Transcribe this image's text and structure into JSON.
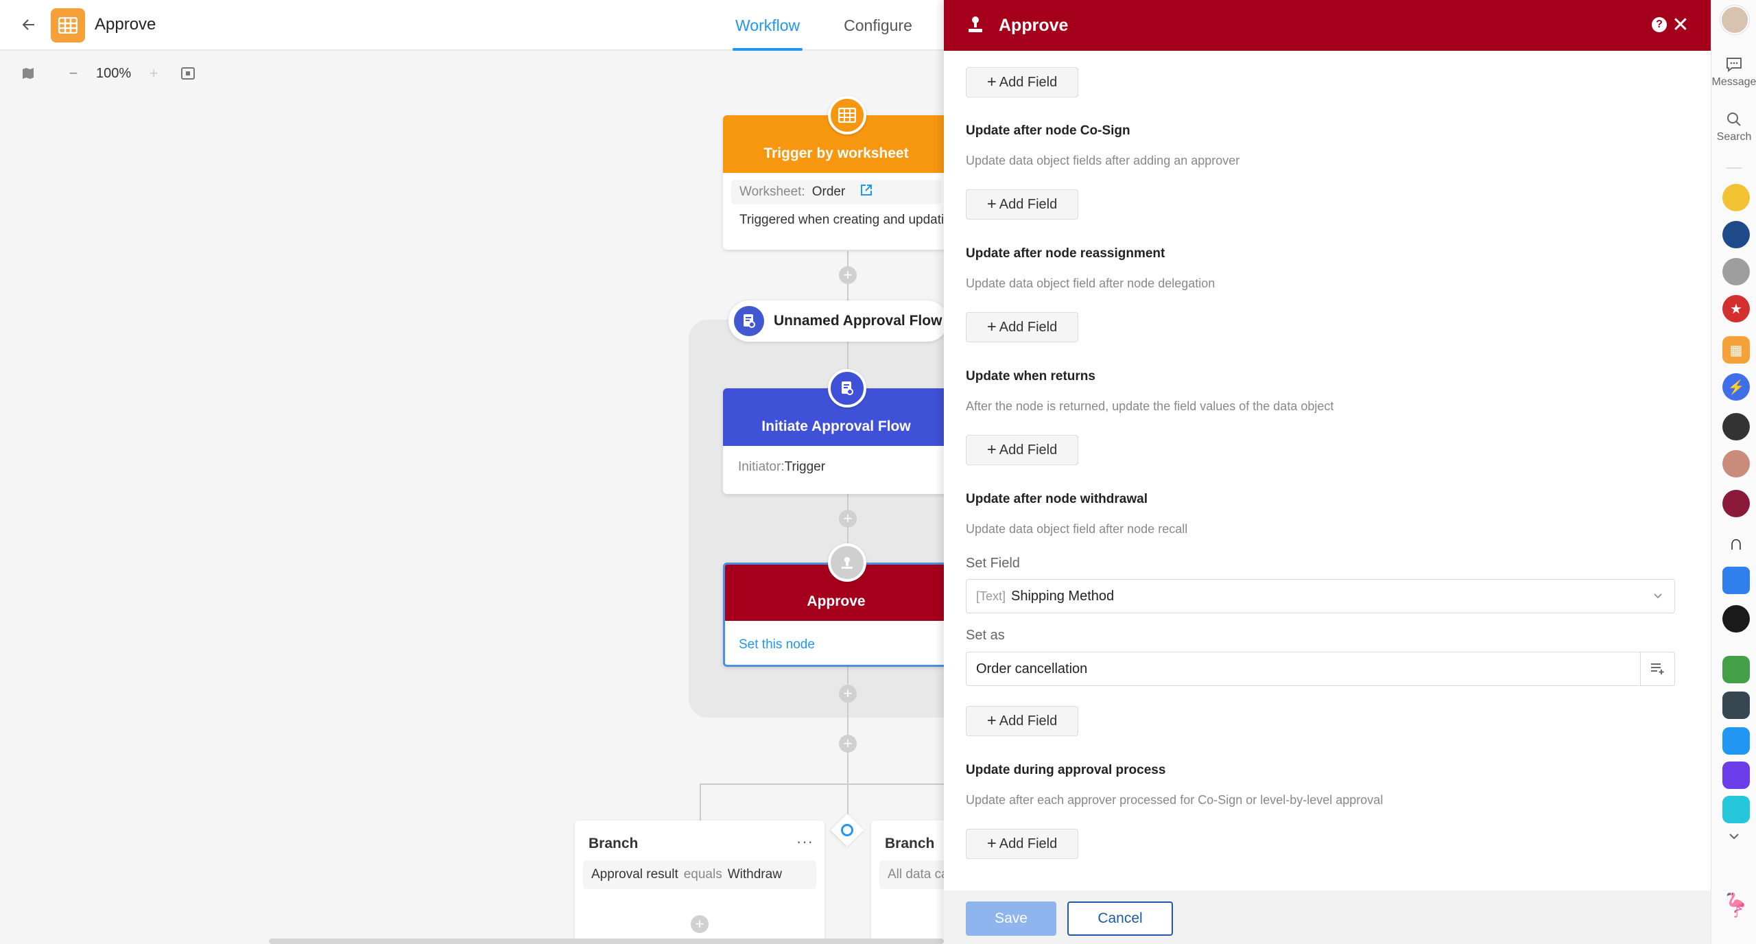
{
  "header": {
    "app_title": "Approve",
    "tabs": [
      {
        "label": "Workflow",
        "active": true
      },
      {
        "label": "Configure",
        "active": false
      }
    ]
  },
  "canvas_toolbar": {
    "zoom": "100%"
  },
  "workflow": {
    "trigger": {
      "title": "Trigger by worksheet",
      "worksheet_label": "Worksheet:",
      "worksheet_value": "Order",
      "description": "Triggered when creating and updatin"
    },
    "approval_flow_pill": "Unnamed Approval Flow",
    "initiate": {
      "title": "Initiate Approval Flow",
      "initiator_label": "Initiator:",
      "initiator_value": "Trigger"
    },
    "approve_node": {
      "title": "Approve",
      "link": "Set this node"
    },
    "branches": [
      {
        "title": "Branch",
        "field": "Approval result",
        "op": "equals",
        "value": "Withdraw"
      },
      {
        "title": "Branch",
        "field": "All data ca",
        "op": "",
        "value": ""
      }
    ]
  },
  "drawer": {
    "title": "Approve",
    "add_field_label": "Add Field",
    "sections": [
      {
        "title": "Update after node Co-Sign",
        "desc": "Update data object fields after adding an approver"
      },
      {
        "title": "Update after node reassignment",
        "desc": "Update data object field after node delegation"
      },
      {
        "title": "Update when returns",
        "desc": "After the node is returned, update the field values of the data object"
      },
      {
        "title": "Update after node withdrawal",
        "desc": "Update data object field after node recall"
      },
      {
        "title": "Update during approval process",
        "desc": "Update after each approver processed for Co-Sign or level-by-level approval"
      }
    ],
    "set_field_label": "Set Field",
    "set_field_type": "[Text]",
    "set_field_value": "Shipping Method",
    "set_as_label": "Set as",
    "set_as_value": "Order cancellation",
    "save_label": "Save",
    "cancel_label": "Cancel"
  },
  "dock": {
    "message_label": "Message",
    "search_label": "Search"
  },
  "colors": {
    "accent": "#2196f3",
    "drawer_header": "#a5001b",
    "trigger": "#f7960f",
    "initiate": "#3f51d6",
    "approve": "#a5001b"
  }
}
